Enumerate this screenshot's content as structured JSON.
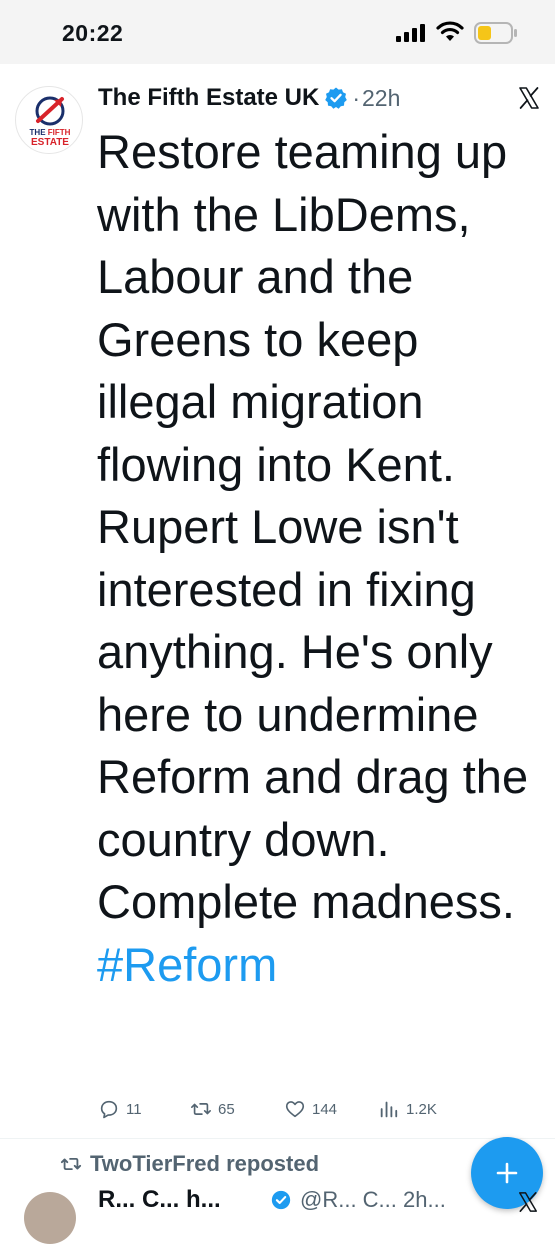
{
  "status_bar": {
    "time": "20:22",
    "icons": [
      "signal-icon",
      "wifi-icon",
      "battery-icon"
    ],
    "battery_color": "#f5c518"
  },
  "tweet": {
    "author": "The Fifth Estate UK",
    "separator": "·",
    "time": "22h",
    "avatar_logo": {
      "line1": "THE FIFTH",
      "line2": "ESTATE"
    },
    "text": "Restore teaming up with the LibDems, Labour and the Greens to keep illegal migration flowing into Kent. Rupert Lowe isn't interested in fixing anything. He's only here to undermine Reform and drag the country down. Complete madness. ",
    "hashtag": "#Reform",
    "replies": "11",
    "reposts": "65",
    "likes": "144",
    "views": "1.2K",
    "accent_color": "#1d9bf0"
  },
  "next_tweet": {
    "reposted_by": "TwoTierFred reposted",
    "author": "R... C... h...",
    "handle": "@R... C... 2h..."
  }
}
